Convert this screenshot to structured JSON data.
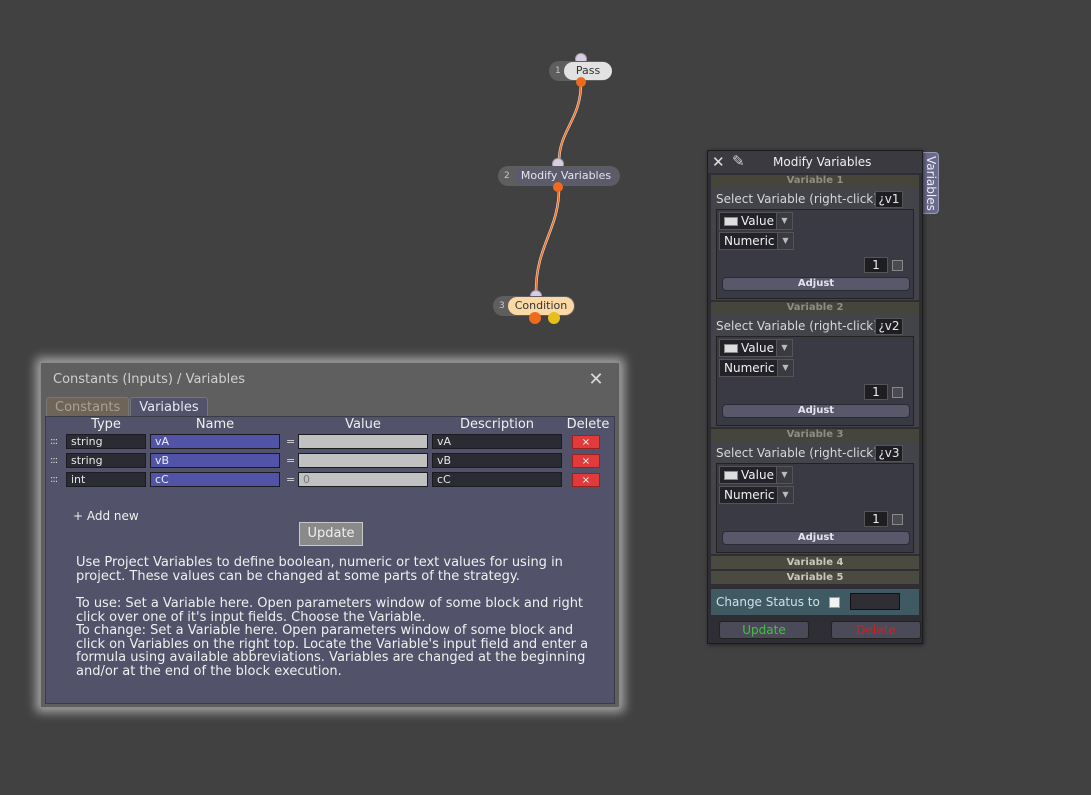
{
  "flow": {
    "nodes": [
      {
        "num": "1",
        "label": "Pass"
      },
      {
        "num": "2",
        "label": "Modify Variables"
      },
      {
        "num": "3",
        "label": "Condition"
      }
    ]
  },
  "constants_panel": {
    "title": "Constants (Inputs) / Variables",
    "tabs": [
      {
        "label": "Constants",
        "active": false
      },
      {
        "label": "Variables",
        "active": true
      }
    ],
    "columns": [
      "Type",
      "Name",
      "Value",
      "Description",
      "Delete"
    ],
    "grip": ":::",
    "rows": [
      {
        "type": "string",
        "name": "vA",
        "eq": "=",
        "value": "",
        "description": "vA",
        "delete": "×"
      },
      {
        "type": "string",
        "name": "vB",
        "eq": "=",
        "value": "",
        "description": "vB",
        "delete": "×"
      },
      {
        "type": "int",
        "name": "cC",
        "eq": "=",
        "value": "0",
        "description": "cC",
        "delete": "×"
      }
    ],
    "add_new": "+ Add new",
    "update_label": "Update",
    "help": [
      "Use Project Variables to define boolean, numeric or text values for using in project. These values can be changed at some parts of the strategy.",
      "To use: Set a Variable here. Open parameters window of some block and right click over one of it's input fields. Choose the Variable.",
      "To change: Set a Variable here. Open parameters window of some block and click on Variables on the right top. Locate the Variable's input field and enter a formula using available abbreviations. Variables are changed at the beginning and/or at the end of the block execution."
    ]
  },
  "modify_panel": {
    "title": "Modify Variables",
    "side_tab": "Variables",
    "variables": [
      {
        "header": "Variable 1",
        "select_label": "Select Variable (right-click)",
        "var_name": "¿v1",
        "mode": "Value",
        "kind": "Numeric",
        "amount": "1",
        "adjust": "Adjust"
      },
      {
        "header": "Variable 2",
        "select_label": "Select Variable (right-click)",
        "var_name": "¿v2",
        "mode": "Value",
        "kind": "Numeric",
        "amount": "1",
        "adjust": "Adjust"
      },
      {
        "header": "Variable 3",
        "select_label": "Select Variable (right-click)",
        "var_name": "¿v3",
        "mode": "Value",
        "kind": "Numeric",
        "amount": "1",
        "adjust": "Adjust"
      }
    ],
    "collapsed": [
      "Variable 4",
      "Variable 5"
    ],
    "change_status_label": "Change Status to",
    "update_label": "Update",
    "delete_label": "Delete",
    "colors": {
      "update": "#3fc23f",
      "delete": "#d02020",
      "wire": "#ef6a1e"
    }
  }
}
